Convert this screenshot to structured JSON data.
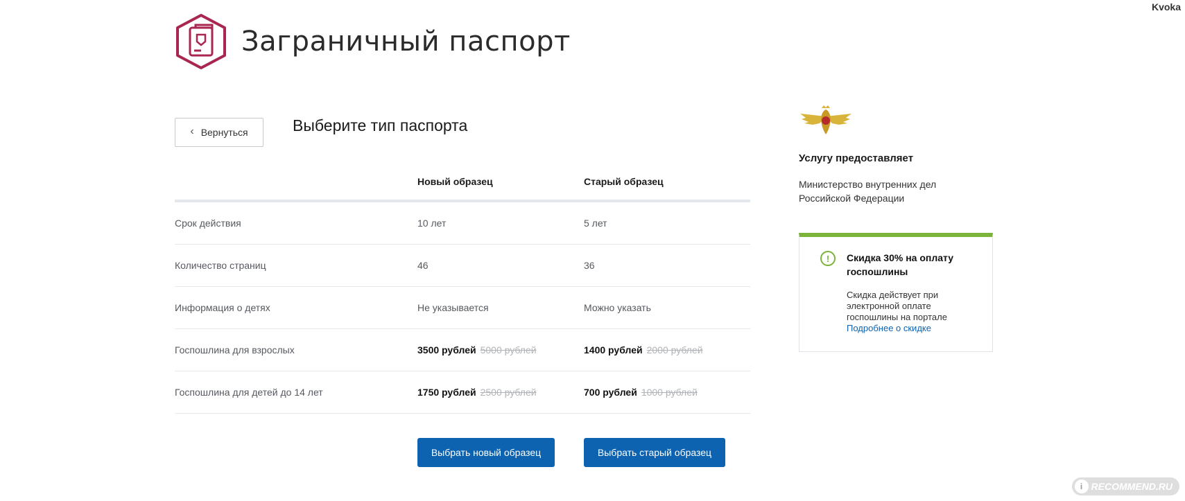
{
  "watermark_user": "Kvoka",
  "header": {
    "title": "Заграничный паспорт"
  },
  "back_button": {
    "label": "Вернуться"
  },
  "section_title": "Выберите тип паспорта",
  "table": {
    "columns": [
      "Новый образец",
      "Старый образец"
    ],
    "rows": [
      {
        "label": "Срок действия",
        "new": "10 лет",
        "old": "5 лет"
      },
      {
        "label": "Количество страниц",
        "new": "46",
        "old": "36"
      },
      {
        "label": "Информация о детях",
        "new": "Не указывается",
        "old": "Можно указать"
      },
      {
        "label": "Госпошлина для взрослых",
        "new": "3500 рублей",
        "new_old_price": "5000 рублей",
        "old": "1400 рублей",
        "old_old_price": "2000 рублей"
      },
      {
        "label": "Госпошлина для детей до 14 лет",
        "new": "1750 рублей",
        "new_old_price": "2500 рублей",
        "old": "700 рублей",
        "old_old_price": "1000 рублей"
      }
    ]
  },
  "actions": {
    "choose_new": "Выбрать новый образец",
    "choose_old": "Выбрать старый образец"
  },
  "provider": {
    "heading": "Услугу предоставляет",
    "name": "Министерство внутренних дел Российской Федерации"
  },
  "discount": {
    "title": "Скидка 30% на оплату госпошлины",
    "text": "Скидка действует при электронной оплате госпошлины на портале",
    "link": "Подробнее о скидке"
  },
  "watermark_logo": "RECOMMEND.RU",
  "colors": {
    "primary": "#0d63b0",
    "accent_green": "#7bb33b",
    "icon_crimson": "#a8264f"
  }
}
